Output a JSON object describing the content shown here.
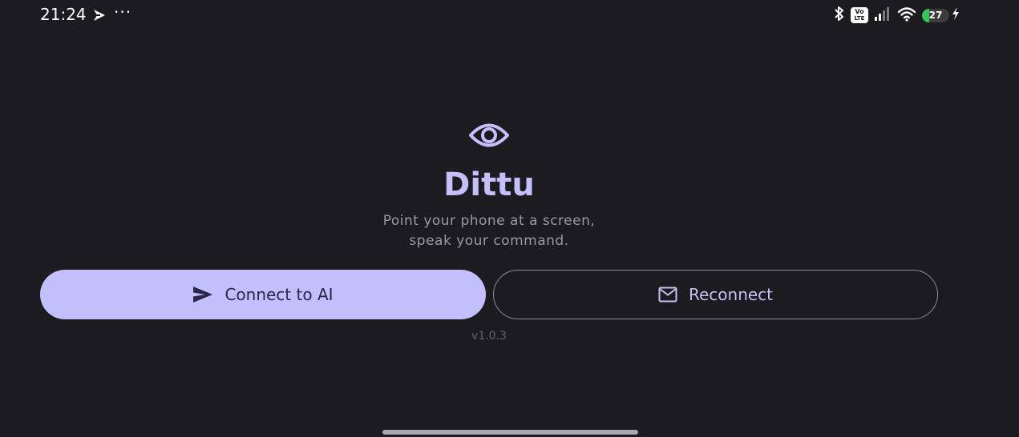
{
  "status_bar": {
    "time": "21:24",
    "more_indicator": "···",
    "battery_level": "27",
    "battery_fraction": 0.27,
    "network_badge_top": "Vo",
    "network_badge_bottom": "LTE",
    "icons": [
      "navigation-arrow-icon",
      "bluetooth-icon",
      "volte-icon",
      "cellular-signal-icon",
      "wifi-icon",
      "battery-icon",
      "charging-bolt-icon"
    ]
  },
  "main": {
    "icon": "eye-icon",
    "title": "Dittu",
    "tagline_line1": "Point your phone at a screen,",
    "tagline_line2": "speak your command.",
    "connect_button": {
      "label": "Connect to AI",
      "icon": "send-icon"
    },
    "reconnect_button": {
      "label": "Reconnect",
      "icon": "mail-icon"
    },
    "version": "v1.0.3"
  },
  "colors": {
    "background": "#1c1b20",
    "accent": "#c5bffa",
    "primary_button": "#c3bffd",
    "battery_green": "#34c759"
  }
}
